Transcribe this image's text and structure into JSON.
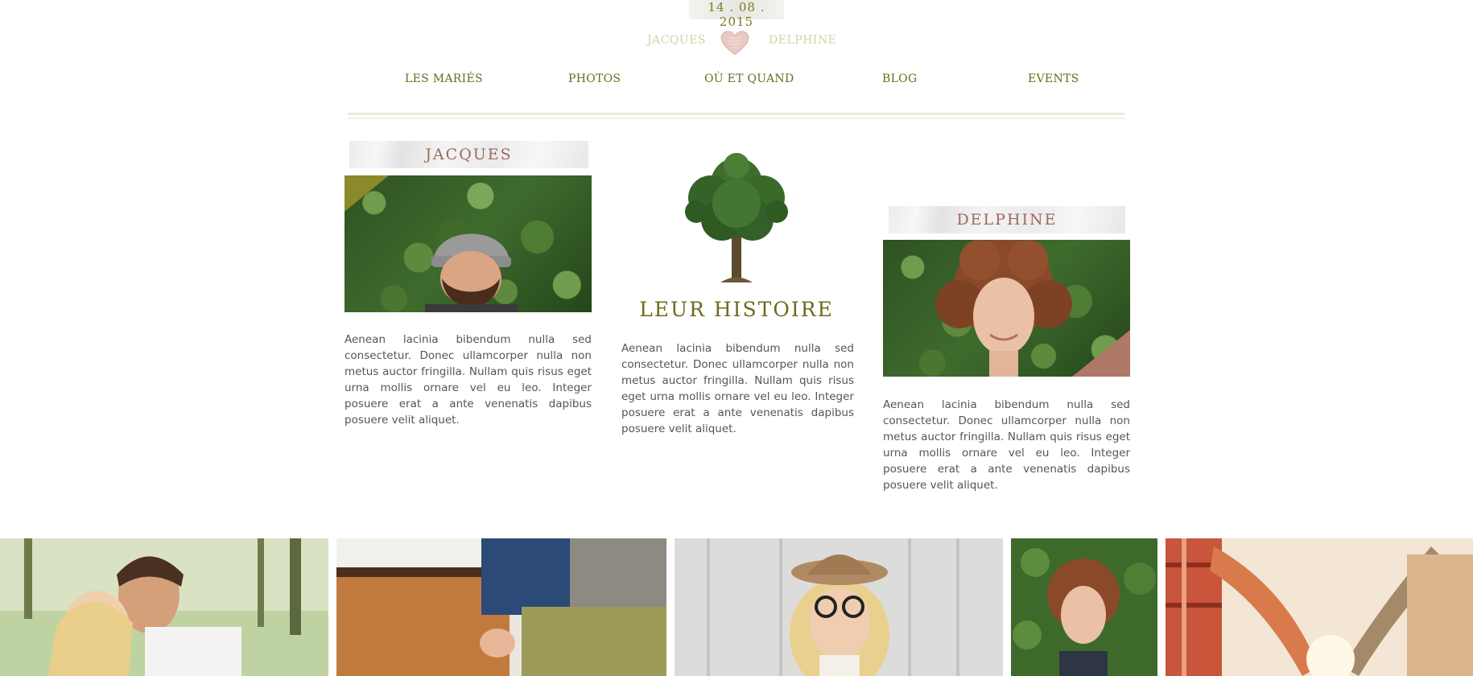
{
  "header": {
    "date": "14 . 08 . 2015",
    "groom_name": "JACQUES",
    "bride_name": "DELPHINE"
  },
  "nav": {
    "items": [
      {
        "label": "LES MARIÉS"
      },
      {
        "label": "PHOTOS"
      },
      {
        "label": "OÙ ET QUAND"
      },
      {
        "label": "BLOG"
      },
      {
        "label": "EVENTS"
      }
    ]
  },
  "profiles": {
    "groom": {
      "name": "JACQUES",
      "bio": "Aenean lacinia bibendum nulla sed consectetur. Donec ullamcorper nulla non metus auctor fringilla. Nullam quis risus eget urna mollis ornare vel eu leo. Integer posuere erat a ante venenatis dapibus posuere velit aliquet."
    },
    "bride": {
      "name": "DELPHINE",
      "bio": "Aenean lacinia bibendum nulla sed consectetur. Donec ullamcorper nulla non metus auctor fringilla. Nullam quis risus eget urna mollis ornare vel eu leo. Integer posuere erat a ante venenatis dapibus posuere velit aliquet."
    }
  },
  "story": {
    "title": "LEUR HISTOIRE",
    "text": "Aenean lacinia bibendum nulla sed consectetur. Donec ullamcorper nulla non metus auctor fringilla. Nullam quis risus eget urna mollis ornare vel eu leo. Integer posuere erat a ante venenatis dapibus posuere velit aliquet."
  },
  "colors": {
    "olive": "#6e6b1d",
    "name_rose": "#a0685a",
    "couple_green": "#c8d9a6",
    "text_gray": "#555555"
  }
}
